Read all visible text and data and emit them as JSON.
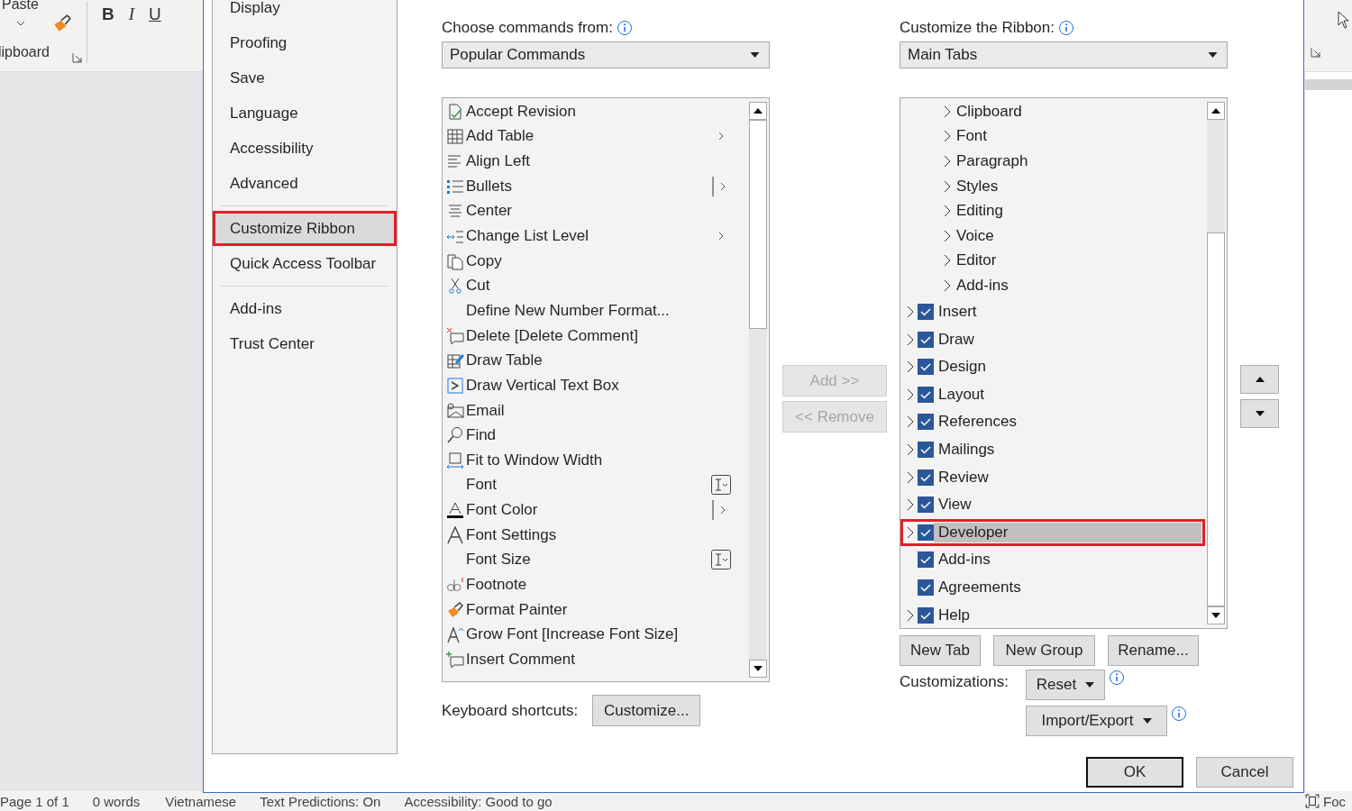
{
  "word_window": {
    "ribbon": {
      "paste_label": "Paste",
      "group_label": "lipboard",
      "bold": "B",
      "italic": "I",
      "underline": "U"
    },
    "status_bar": [
      "Page 1 of 1",
      "0 words",
      "Vietnamese",
      "Text Predictions: On",
      "Accessibility: Good to go"
    ],
    "focus_label": "Foc"
  },
  "dialog": {
    "nav": [
      [
        {
          "label": "Display",
          "selected": false,
          "highlighted": false
        },
        {
          "label": "Proofing",
          "selected": false,
          "highlighted": false
        },
        {
          "label": "Save",
          "selected": false,
          "highlighted": false
        },
        {
          "label": "Language",
          "selected": false,
          "highlighted": false
        },
        {
          "label": "Accessibility",
          "selected": false,
          "highlighted": false
        },
        {
          "label": "Advanced",
          "selected": false,
          "highlighted": false
        }
      ],
      [
        {
          "label": "Customize Ribbon",
          "selected": true,
          "highlighted": true
        },
        {
          "label": "Quick Access Toolbar",
          "selected": false,
          "highlighted": false
        }
      ],
      [
        {
          "label": "Add-ins",
          "selected": false,
          "highlighted": false
        },
        {
          "label": "Trust Center",
          "selected": false,
          "highlighted": false
        }
      ]
    ],
    "commands": {
      "label": "Choose commands from:",
      "dropdown": "Popular Commands",
      "items": [
        {
          "label": "Accept Revision",
          "kind": "plain"
        },
        {
          "label": "Add Table",
          "kind": "submenu"
        },
        {
          "label": "Align Left",
          "kind": "plain"
        },
        {
          "label": "Bullets",
          "kind": "split"
        },
        {
          "label": "Center",
          "kind": "plain"
        },
        {
          "label": "Change List Level",
          "kind": "submenu"
        },
        {
          "label": "Copy",
          "kind": "plain"
        },
        {
          "label": "Cut",
          "kind": "plain"
        },
        {
          "label": "Define New Number Format...",
          "kind": "plain"
        },
        {
          "label": "Delete [Delete Comment]",
          "kind": "plain"
        },
        {
          "label": "Draw Table",
          "kind": "plain"
        },
        {
          "label": "Draw Vertical Text Box",
          "kind": "plain"
        },
        {
          "label": "Email",
          "kind": "plain"
        },
        {
          "label": "Find",
          "kind": "plain"
        },
        {
          "label": "Fit to Window Width",
          "kind": "plain"
        },
        {
          "label": "Font",
          "kind": "combo"
        },
        {
          "label": "Font Color",
          "kind": "split"
        },
        {
          "label": "Font Settings",
          "kind": "plain"
        },
        {
          "label": "Font Size",
          "kind": "combo"
        },
        {
          "label": "Footnote",
          "kind": "plain"
        },
        {
          "label": "Format Painter",
          "kind": "plain"
        },
        {
          "label": "Grow Font [Increase Font Size]",
          "kind": "plain"
        },
        {
          "label": "Insert Comment",
          "kind": "plain"
        }
      ]
    },
    "add_button": {
      "label": "Add >>",
      "disabled": true
    },
    "remove_button": {
      "label": "<< Remove",
      "disabled": true
    },
    "keyboard_shortcuts": {
      "label": "Keyboard shortcuts:",
      "button": "Customize..."
    },
    "ribbon": {
      "label": "Customize the Ribbon:",
      "dropdown": "Main Tabs",
      "groups": [
        {
          "label": "Clipboard"
        },
        {
          "label": "Font"
        },
        {
          "label": "Paragraph"
        },
        {
          "label": "Styles"
        },
        {
          "label": "Editing"
        },
        {
          "label": "Voice"
        },
        {
          "label": "Editor"
        },
        {
          "label": "Add-ins"
        }
      ],
      "tabs": [
        {
          "label": "Insert",
          "checked": true,
          "collapsible": true,
          "selected": false,
          "highlighted": false
        },
        {
          "label": "Draw",
          "checked": true,
          "collapsible": true,
          "selected": false,
          "highlighted": false
        },
        {
          "label": "Design",
          "checked": true,
          "collapsible": true,
          "selected": false,
          "highlighted": false
        },
        {
          "label": "Layout",
          "checked": true,
          "collapsible": true,
          "selected": false,
          "highlighted": false
        },
        {
          "label": "References",
          "checked": true,
          "collapsible": true,
          "selected": false,
          "highlighted": false
        },
        {
          "label": "Mailings",
          "checked": true,
          "collapsible": true,
          "selected": false,
          "highlighted": false
        },
        {
          "label": "Review",
          "checked": true,
          "collapsible": true,
          "selected": false,
          "highlighted": false
        },
        {
          "label": "View",
          "checked": true,
          "collapsible": true,
          "selected": false,
          "highlighted": false
        },
        {
          "label": "Developer",
          "checked": true,
          "collapsible": true,
          "selected": true,
          "highlighted": true
        },
        {
          "label": "Add-ins",
          "checked": true,
          "collapsible": false,
          "selected": false,
          "highlighted": false
        },
        {
          "label": "Agreements",
          "checked": true,
          "collapsible": false,
          "selected": false,
          "highlighted": false
        },
        {
          "label": "Help",
          "checked": true,
          "collapsible": true,
          "selected": false,
          "highlighted": false
        }
      ]
    },
    "tree_buttons": [
      "New Tab",
      "New Group",
      "Rename..."
    ],
    "customizations": {
      "label": "Customizations:",
      "reset": "Reset",
      "import_export": "Import/Export"
    },
    "footer": [
      "OK",
      "Cancel"
    ]
  }
}
